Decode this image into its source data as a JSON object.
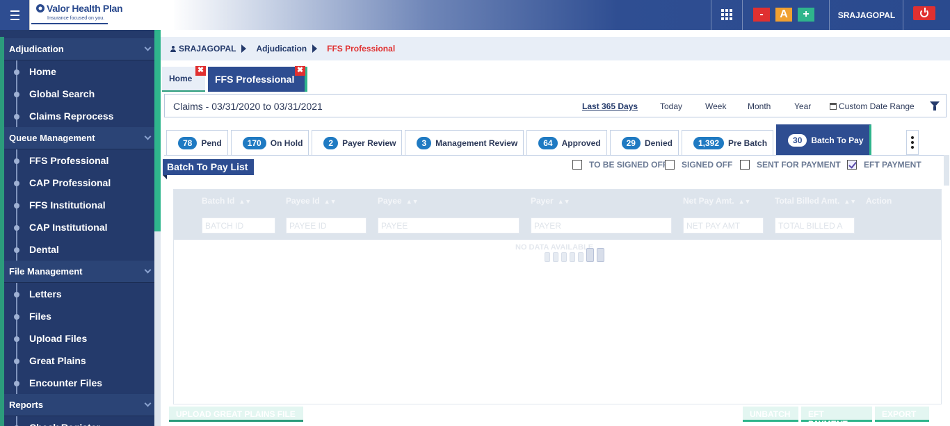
{
  "brand": {
    "name": "Valor Health Plan",
    "tagline": "Insurance focused on you."
  },
  "header": {
    "user": "SRAJAGOPAL",
    "font_decrease": "-",
    "font_reset": "A",
    "font_increase": "+"
  },
  "sidebar": {
    "sections": [
      {
        "title": "Adjudication",
        "items": [
          "Home",
          "Global Search",
          "Claims Reprocess"
        ]
      },
      {
        "title": "Queue Management",
        "items": [
          "FFS Professional",
          "CAP Professional",
          "FFS Institutional",
          "CAP Institutional",
          "Dental"
        ]
      },
      {
        "title": "File Management",
        "items": [
          "Letters",
          "Files",
          "Upload Files",
          "Great Plains",
          "Encounter Files"
        ]
      },
      {
        "title": "Reports",
        "items": [
          "Check Register"
        ]
      }
    ]
  },
  "breadcrumb": {
    "user": "SRAJAGOPAL",
    "section": "Adjudication",
    "current": "FFS Professional"
  },
  "page_tabs": {
    "home": "Home",
    "ffs": "FFS Professional",
    "close": "✖"
  },
  "filter": {
    "claims_range": "Claims - 03/31/2020 to 03/31/2021",
    "options": {
      "last365": "Last 365 Days",
      "today": "Today",
      "week": "Week",
      "month": "Month",
      "year": "Year",
      "custom": "Custom Date Range"
    }
  },
  "status_tabs": {
    "pend": {
      "count": "78",
      "label": "Pend"
    },
    "on_hold": {
      "count": "170",
      "label": "On Hold"
    },
    "payer_review": {
      "count": "2",
      "label": "Payer Review"
    },
    "mgmt_review": {
      "count": "3",
      "label": "Management Review"
    },
    "approved": {
      "count": "64",
      "label": "Approved"
    },
    "denied": {
      "count": "29",
      "label": "Denied"
    },
    "pre_batch": {
      "count": "1,392",
      "label": "Pre Batch"
    },
    "batch_to_pay": {
      "count": "30",
      "label": "Batch To Pay"
    }
  },
  "list": {
    "title": "Batch To Pay List",
    "checks": {
      "signed_off_pending": "TO BE SIGNED OFF",
      "signed_off": "SIGNED OFF",
      "sent": "SENT FOR PAYMENT",
      "eft": "EFT PAYMENT"
    },
    "eft_checked": true
  },
  "grid": {
    "columns": {
      "batch_id": "Batch Id",
      "payee_id": "Payee Id",
      "payee": "Payee",
      "payer": "Payer",
      "net_pay": "Net Pay Amt.",
      "total_billed": "Total Billed Amt.",
      "action": "Action"
    },
    "filters": {
      "batch_id": "BATCH ID",
      "payee_id": "PAYEE ID",
      "payee": "PAYEE",
      "payer": "PAYER",
      "net_pay": "NET PAY AMT",
      "total_billed": "TOTAL BILLED A"
    },
    "empty": "NO DATA AVAILABLE"
  },
  "footer": {
    "upload": "UPLOAD GREAT PLAINS FILE",
    "unbatch": "UNBATCH",
    "eft": "EFT PAYMENT",
    "export": "EXPORT"
  },
  "colors": {
    "navy": "#2e4d91",
    "accent": "#2fb58c",
    "alert": "#e03030"
  }
}
